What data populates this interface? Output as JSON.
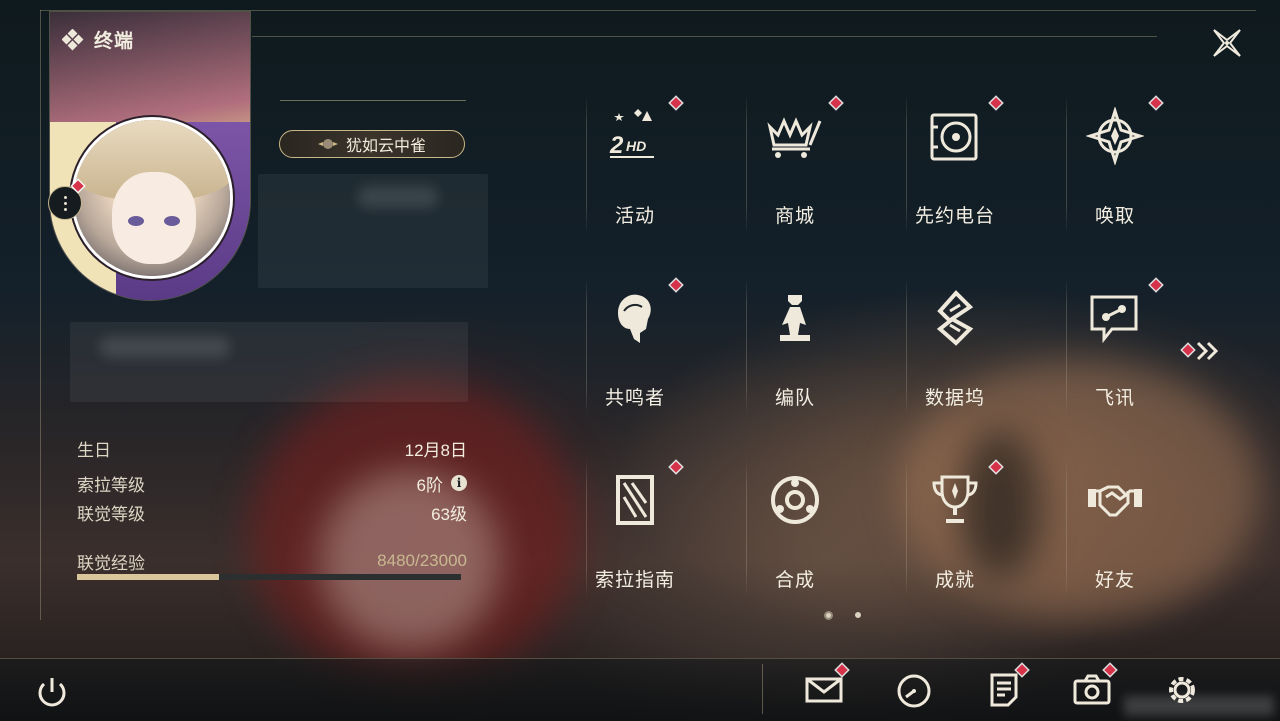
{
  "window": {
    "title": "终端"
  },
  "profile": {
    "nickname": "犹如云中雀",
    "stats": [
      {
        "label": "生日",
        "value": "12月8日"
      },
      {
        "label": "索拉等级",
        "value": "6阶"
      },
      {
        "label": "联觉等级",
        "value": "63级"
      }
    ],
    "exp": {
      "label": "联觉经验",
      "value": "8480/23000",
      "current": 8480,
      "max": 23000
    }
  },
  "menu": [
    {
      "label": "活动",
      "icon": "event-2hd-icon",
      "badge": true
    },
    {
      "label": "商城",
      "icon": "shop-cart-icon",
      "badge": true
    },
    {
      "label": "先约电台",
      "icon": "radio-record-icon",
      "badge": true
    },
    {
      "label": "唤取",
      "icon": "convene-star-icon",
      "badge": true
    },
    {
      "label": "共鸣者",
      "icon": "resonator-head-icon",
      "badge": true
    },
    {
      "label": "编队",
      "icon": "team-chess-icon",
      "badge": false
    },
    {
      "label": "数据坞",
      "icon": "data-bank-icon",
      "badge": false
    },
    {
      "label": "飞讯",
      "icon": "message-chat-icon",
      "badge": true
    },
    {
      "label": "索拉指南",
      "icon": "guide-book-icon",
      "badge": true
    },
    {
      "label": "合成",
      "icon": "synthesis-icon",
      "badge": false
    },
    {
      "label": "成就",
      "icon": "achievement-trophy-icon",
      "badge": true
    },
    {
      "label": "好友",
      "icon": "friends-handshake-icon",
      "badge": false
    }
  ],
  "pagination": {
    "current": 1,
    "total": 2
  },
  "bottom_bar": [
    {
      "name": "mail",
      "icon": "mail-icon",
      "badge": true
    },
    {
      "name": "clock",
      "icon": "clock-icon",
      "badge": false
    },
    {
      "name": "notes",
      "icon": "notes-icon",
      "badge": true
    },
    {
      "name": "camera",
      "icon": "camera-icon",
      "badge": true
    },
    {
      "name": "settings",
      "icon": "gear-icon",
      "badge": false
    }
  ],
  "colors": {
    "badge": "#d6324a",
    "accent": "#d9c69a",
    "text": "#f3eee2"
  }
}
